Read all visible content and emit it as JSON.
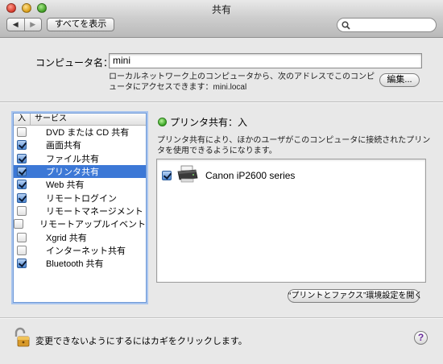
{
  "window": {
    "title": "共有"
  },
  "toolbar": {
    "back_glyph": "◀",
    "forward_glyph": "▶",
    "show_all_label": "すべてを表示",
    "search_placeholder": ""
  },
  "computer_name": {
    "label": "コンピュータ名：",
    "value": "mini",
    "description": "ローカルネットワーク上のコンピュータから、次のアドレスでこのコンピュータにアクセスできます：mini.local",
    "edit_label": "編集..."
  },
  "services": {
    "header_on": "入",
    "header_service": "サービス",
    "items": [
      {
        "label": "DVD または CD 共有",
        "checked": false
      },
      {
        "label": "画面共有",
        "checked": true
      },
      {
        "label": "ファイル共有",
        "checked": true
      },
      {
        "label": "プリンタ共有",
        "checked": true,
        "selected": true
      },
      {
        "label": "Web 共有",
        "checked": true
      },
      {
        "label": "リモートログイン",
        "checked": true
      },
      {
        "label": "リモートマネージメント",
        "checked": false
      },
      {
        "label": "リモートアップルイベント",
        "checked": false
      },
      {
        "label": "Xgrid 共有",
        "checked": false
      },
      {
        "label": "インターネット共有",
        "checked": false
      },
      {
        "label": "Bluetooth 共有",
        "checked": true
      }
    ]
  },
  "printer_sharing": {
    "status": "プリンタ共有：入",
    "status_color": "#2e9d1b",
    "description": "プリンタ共有により、ほかのユーザがこのコンピュータに接続されたプリンタを使用できるようになります。",
    "printers": [
      {
        "name": "Canon iP2600 series",
        "checked": true,
        "icon": "printer-icon"
      }
    ],
    "prefs_button": "“プリントとファクス”環境設定を開く"
  },
  "footer": {
    "lock_text": "変更できないようにするにはカギをクリックします。",
    "help_glyph": "?"
  }
}
